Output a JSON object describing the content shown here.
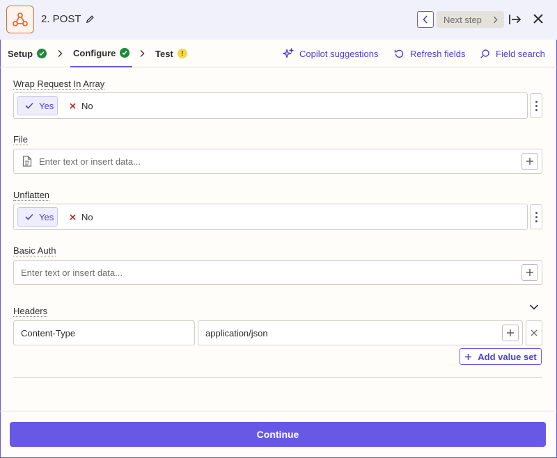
{
  "header": {
    "step_title": "2. POST",
    "next_step_label": "Next step"
  },
  "tabs": [
    {
      "label": "Setup",
      "status": "complete"
    },
    {
      "label": "Configure",
      "status": "complete"
    },
    {
      "label": "Test",
      "status": "warning"
    }
  ],
  "actions": {
    "copilot": "Copilot suggestions",
    "refresh": "Refresh fields",
    "search": "Field search"
  },
  "fields": {
    "wrap_request": {
      "label": "Wrap Request In Array",
      "yes": "Yes",
      "no": "No",
      "selected": "Yes"
    },
    "file": {
      "label": "File",
      "placeholder": "Enter text or insert data..."
    },
    "unflatten": {
      "label": "Unflatten",
      "yes": "Yes",
      "no": "No",
      "selected": "Yes"
    },
    "basic_auth": {
      "label": "Basic Auth",
      "placeholder": "Enter text or insert data..."
    },
    "headers": {
      "label": "Headers",
      "rows": [
        {
          "key": "Content-Type",
          "value": "application/json"
        }
      ],
      "add_label": "Add value set"
    }
  },
  "footer": {
    "continue_label": "Continue"
  },
  "colors": {
    "accent": "#6759e6",
    "success": "#1b8a3c",
    "warning": "#f5d64b",
    "brand": "#e06a3b"
  }
}
